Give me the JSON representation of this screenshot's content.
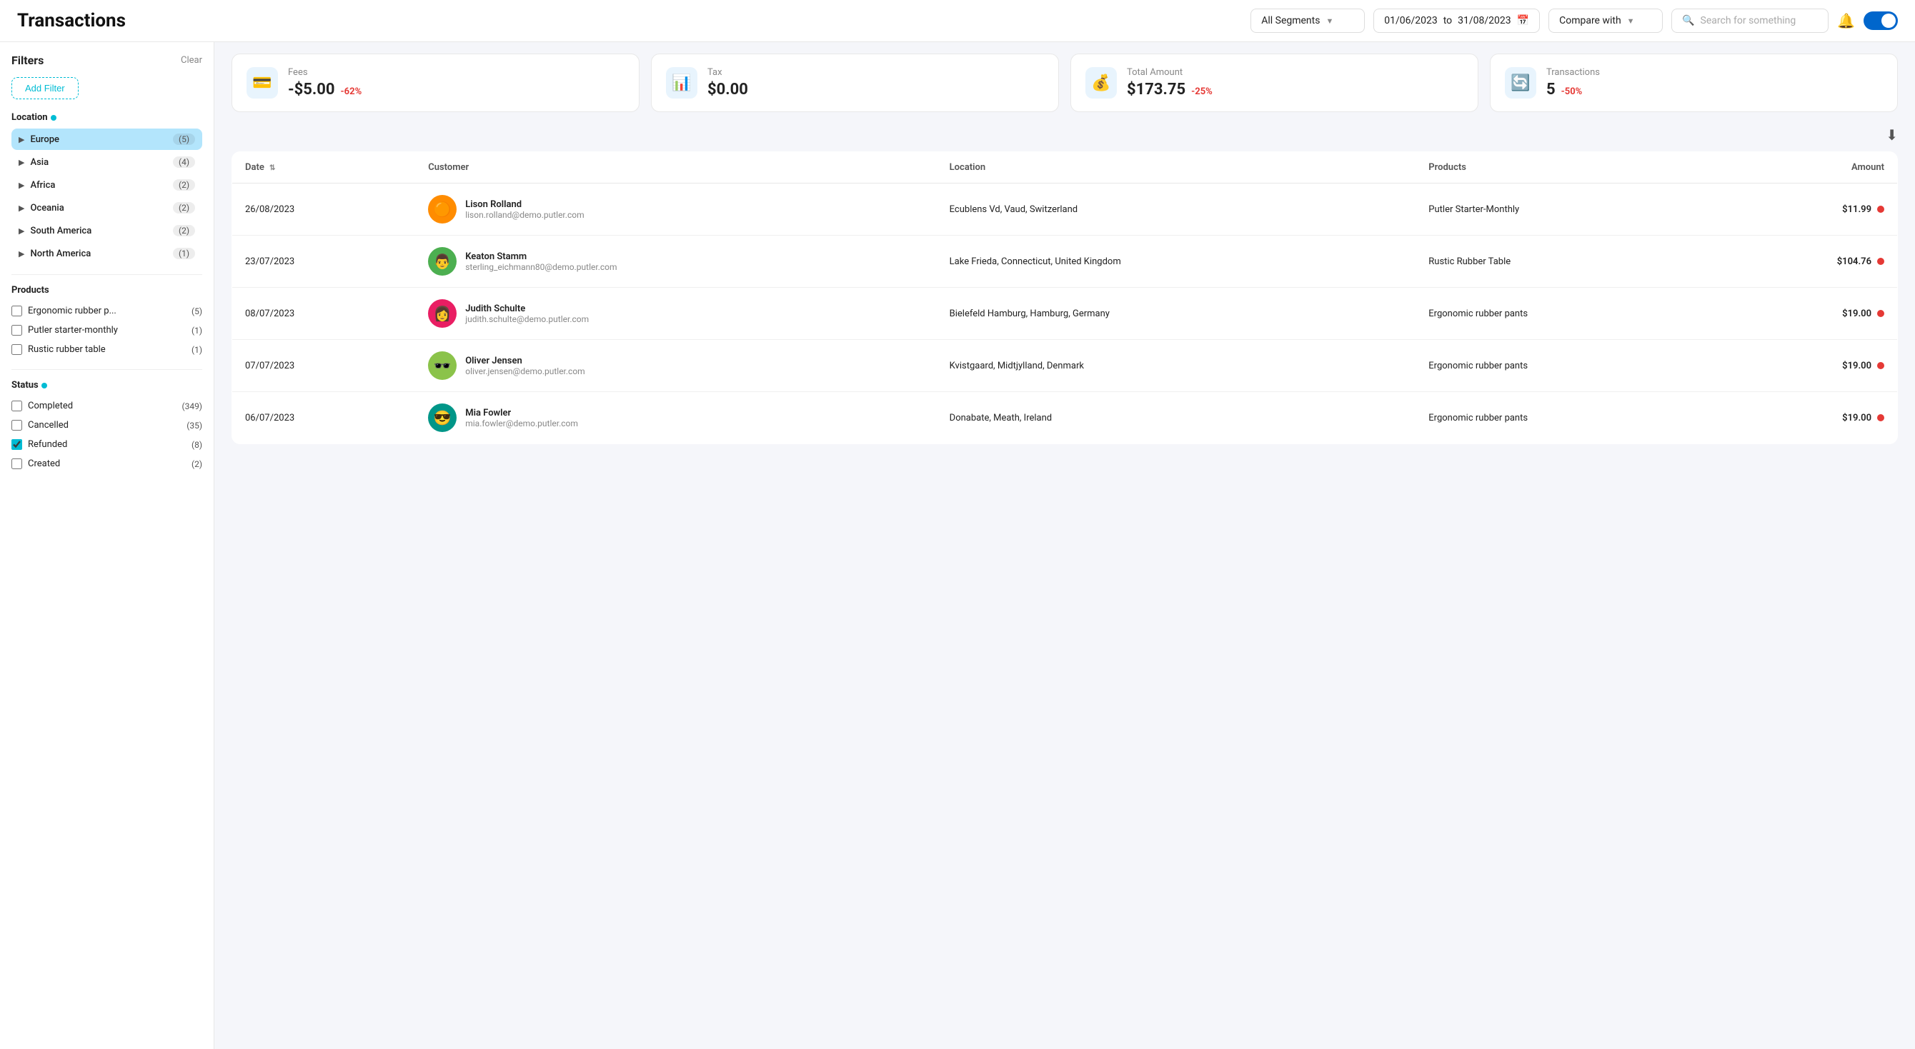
{
  "header": {
    "title": "Transactions",
    "segment_label": "All Segments",
    "date_from": "01/06/2023",
    "date_to": "31/08/2023",
    "compare_with_label": "Compare with",
    "search_placeholder": "Search for something"
  },
  "filters": {
    "title": "Filters",
    "clear_label": "Clear",
    "add_filter_label": "Add Filter",
    "location_section": "Location",
    "location_items": [
      {
        "name": "Europe",
        "count": 5,
        "active": true
      },
      {
        "name": "Asia",
        "count": 4,
        "active": false
      },
      {
        "name": "Africa",
        "count": 2,
        "active": false
      },
      {
        "name": "Oceania",
        "count": 2,
        "active": false
      },
      {
        "name": "South America",
        "count": 2,
        "active": false
      },
      {
        "name": "North America",
        "count": 1,
        "active": false
      }
    ],
    "products_section": "Products",
    "product_items": [
      {
        "name": "Ergonomic rubber p...",
        "count": 5,
        "checked": false
      },
      {
        "name": "Putler starter-monthly",
        "count": 1,
        "checked": false
      },
      {
        "name": "Rustic rubber table",
        "count": 1,
        "checked": false
      }
    ],
    "status_section": "Status",
    "status_items": [
      {
        "name": "Completed",
        "count": 349,
        "checked": false
      },
      {
        "name": "Cancelled",
        "count": 35,
        "checked": false
      },
      {
        "name": "Refunded",
        "count": 8,
        "checked": true
      },
      {
        "name": "Created",
        "count": 2,
        "checked": false
      }
    ]
  },
  "stats": [
    {
      "icon": "💳",
      "label": "Fees",
      "value": "-$5.00",
      "change": "-62%",
      "change_type": "neg"
    },
    {
      "icon": "📊",
      "label": "Tax",
      "value": "$0.00",
      "change": "",
      "change_type": "zero"
    },
    {
      "icon": "💰",
      "label": "Total Amount",
      "value": "$173.75",
      "change": "-25%",
      "change_type": "neg"
    },
    {
      "icon": "🔄",
      "label": "Transactions",
      "value": "5",
      "change": "-50%",
      "change_type": "neg"
    }
  ],
  "table": {
    "columns": [
      "Date",
      "Customer",
      "Location",
      "Products",
      "Amount"
    ],
    "rows": [
      {
        "date": "26/08/2023",
        "customer_name": "Lison Rolland",
        "customer_email": "lison.rolland@demo.putler.com",
        "avatar_emoji": "🟠",
        "avatar_class": "av-orange",
        "location": "Ecublens Vd, Vaud, Switzerland",
        "products": "Putler Starter-Monthly",
        "amount": "$11.99",
        "status_color": "#e53935"
      },
      {
        "date": "23/07/2023",
        "customer_name": "Keaton Stamm",
        "customer_email": "sterling_eichmann80@demo.putler.com",
        "avatar_emoji": "👨",
        "avatar_class": "av-green",
        "location": "Lake Frieda, Connecticut, United Kingdom",
        "products": "Rustic Rubber Table",
        "amount": "$104.76",
        "status_color": "#e53935"
      },
      {
        "date": "08/07/2023",
        "customer_name": "Judith Schulte",
        "customer_email": "judith.schulte@demo.putler.com",
        "avatar_emoji": "👩",
        "avatar_class": "av-pink",
        "location": "Bielefeld Hamburg, Hamburg, Germany",
        "products": "Ergonomic rubber pants",
        "amount": "$19.00",
        "status_color": "#e53935"
      },
      {
        "date": "07/07/2023",
        "customer_name": "Oliver Jensen",
        "customer_email": "oliver.jensen@demo.putler.com",
        "avatar_emoji": "🕶️",
        "avatar_class": "av-olive",
        "location": "Kvistgaard, Midtjylland, Denmark",
        "products": "Ergonomic rubber pants",
        "amount": "$19.00",
        "status_color": "#e53935"
      },
      {
        "date": "06/07/2023",
        "customer_name": "Mia Fowler",
        "customer_email": "mia.fowler@demo.putler.com",
        "avatar_emoji": "😎",
        "avatar_class": "av-teal",
        "location": "Donabate, Meath, Ireland",
        "products": "Ergonomic rubber pants",
        "amount": "$19.00",
        "status_color": "#e53935"
      }
    ]
  }
}
